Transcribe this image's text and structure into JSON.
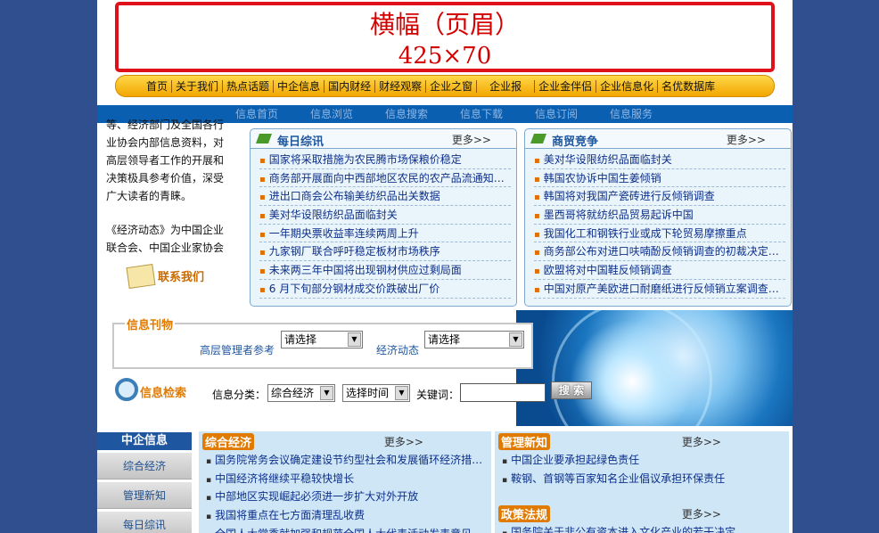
{
  "banner": {
    "line1": "横幅（页眉）",
    "line2": "425×70"
  },
  "top_nav": [
    "首页",
    "关于我们",
    "热点话题",
    "中企信息",
    "国内财经",
    "财经观察",
    "企业之窗",
    "企业报",
    "企业金伴侣",
    "企业信息化",
    "名优数据库"
  ],
  "sub_nav": [
    "信息首页",
    "信息浏览",
    "信息搜索",
    "信息下载",
    "信息订阅",
    "信息服务"
  ],
  "intro": {
    "lines": [
      "等、经济部门及全国各行",
      "业协会内部信息资料，对",
      "高层领导者工作的开展和",
      "决策极具参考价值，深受",
      "广大读者的青睐。",
      "",
      "《经济动态》为中国企业",
      "联合会、中国企业家协会"
    ],
    "contact": "联系我们"
  },
  "daily_news": {
    "title": "每日综讯",
    "more": "更多>>",
    "items": [
      "国家将采取措施为农民腾市场保粮价稳定",
      "商务部开展面向中西部地区农民的农产品流通知…",
      "进出口商会公布输美纺织品出关数据",
      "美对华设限纺织品面临封关",
      "一年期央票收益率连续两周上升",
      "九家钢厂联合呼吁稳定板材市场秩序",
      "未来两三年中国将出现钢材供应过剩局面",
      "6 月下旬部分钢材成交价跌破出厂价"
    ]
  },
  "trade_news": {
    "title": "商贸竞争",
    "more": "更多>>",
    "items": [
      "美对华设限纺织品面临封关",
      "韩国农协诉中国生姜倾销",
      "韩国将对我国产瓷砖进行反倾销调查",
      "墨西哥将就纺织品贸易起诉中国",
      "我国化工和钢铁行业或成下轮贸易摩擦重点",
      "商务部公布对进口呋喃酚反倾销调查的初裁决定…",
      "欧盟将对中国鞋反倾销调查",
      "中国对原产美欧进口耐磨纸进行反倾销立案调查…"
    ]
  },
  "journal": {
    "label": "信息刊物",
    "item1": "高层管理者参考",
    "select1": "请选择",
    "item2": "经济动态",
    "select2": "请选择"
  },
  "search": {
    "label": "信息检索",
    "category_label": "信息分类：",
    "category_value": "综合经济",
    "time_value": "选择时间",
    "keyword_label": "关键词：",
    "keyword_value": "",
    "button": "搜 索"
  },
  "left_menu": {
    "header": "中企信息",
    "items": [
      "综合经济",
      "管理新知",
      "每日综讯"
    ]
  },
  "econ": {
    "title": "综合经济",
    "more": "更多>>",
    "items": [
      "国务院常务会议确定建设节约型社会和发展循环经济措…",
      "中国经济将继续平稳较快增长",
      "中部地区实现崛起必须进一步扩大对外开放",
      "我国将重点在七方面清理乱收费",
      "全国人大常委就加强和规范全国人大代表活动发表意见"
    ]
  },
  "mgmt": {
    "title": "管理新知",
    "more": "更多>>",
    "items": [
      "中国企业要承担起绿色责任",
      "鞍钢、首钢等百家知名企业倡议承担环保责任"
    ]
  },
  "policy": {
    "title": "政策法规",
    "more": "更多>>",
    "items": [
      "国务院关于非公有资本进入文化产业的若干决定"
    ]
  },
  "colors": {
    "accent_red": "#e0101a",
    "nav_gold": "#f2a600",
    "nav_blue": "#0a5fb0",
    "link_blue": "#0c2f8a",
    "orange": "#e07a00"
  }
}
